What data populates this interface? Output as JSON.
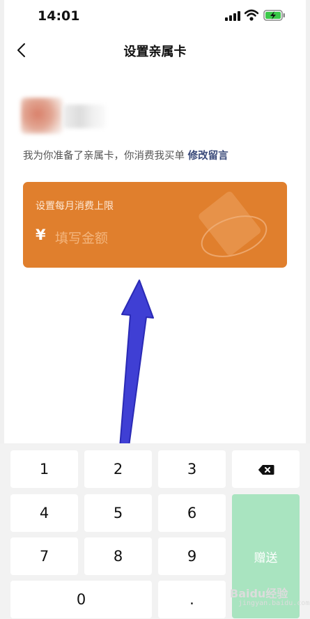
{
  "status_bar": {
    "time": "14:01"
  },
  "nav": {
    "title": "设置亲属卡",
    "back_icon": "chevron-left-icon"
  },
  "message": {
    "text": "我为你准备了亲属卡，你消费我买单",
    "edit_link": "修改留言"
  },
  "card": {
    "label": "设置每月消费上限",
    "currency": "¥",
    "amount_placeholder": "填写金额",
    "amount_value": "",
    "color": "#e07f2d"
  },
  "keypad": {
    "keys": [
      "1",
      "2",
      "3",
      "4",
      "5",
      "6",
      "7",
      "8",
      "9",
      "0",
      "."
    ],
    "backspace_icon": "backspace-icon",
    "send_label": "赠送",
    "send_color": "#a9e4c0"
  },
  "watermark": {
    "text": "Baidu经验",
    "sub": "jingyan.baidu.com"
  }
}
